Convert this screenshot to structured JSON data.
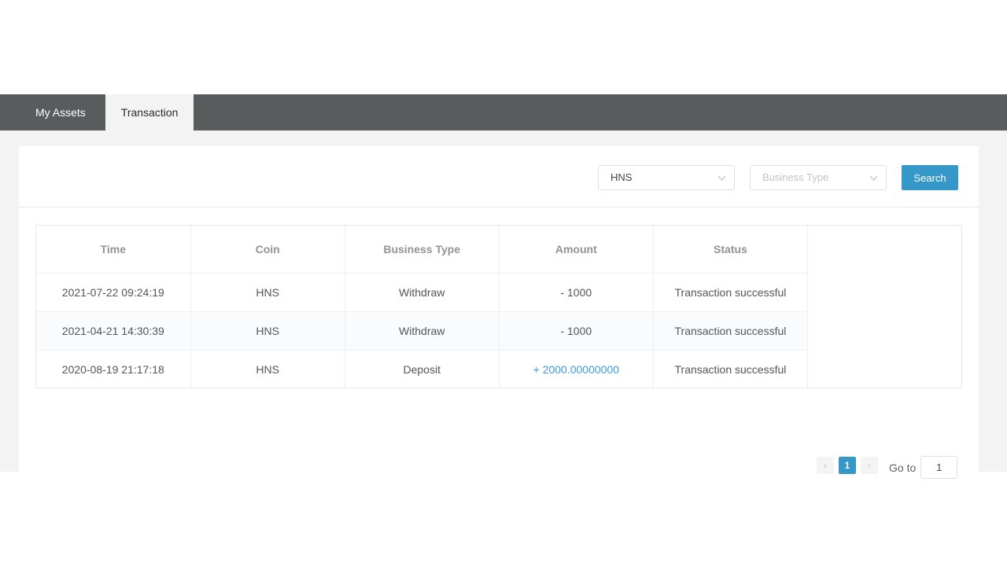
{
  "tabs": [
    {
      "label": "My Assets",
      "active": false
    },
    {
      "label": "Transaction",
      "active": true
    }
  ],
  "filters": {
    "coin_value": "HNS",
    "business_type_placeholder": "Business Type",
    "search_label": "Search"
  },
  "table": {
    "headers": [
      "Time",
      "Coin",
      "Business Type",
      "Amount",
      "Status"
    ],
    "rows": [
      {
        "time": "2021-07-22 09:24:19",
        "coin": "HNS",
        "type": "Withdraw",
        "amount": "- 1000",
        "status": "Transaction successful"
      },
      {
        "time": "2021-04-21 14:30:39",
        "coin": "HNS",
        "type": "Withdraw",
        "amount": "- 1000",
        "status": "Transaction successful"
      },
      {
        "time": "2020-08-19 21:17:18",
        "coin": "HNS",
        "type": "Deposit",
        "amount": "+ 2000.00000000",
        "status": "Transaction successful"
      }
    ]
  },
  "pagination": {
    "prev_icon": "‹",
    "current_page": "1",
    "next_icon": "›",
    "goto_label": "Go to",
    "goto_value": "1"
  },
  "colors": {
    "tabbar": "#585c5c",
    "accent": "#3598c9",
    "positive_amount": "#3a9bd9",
    "background": "#f3f3f3"
  }
}
